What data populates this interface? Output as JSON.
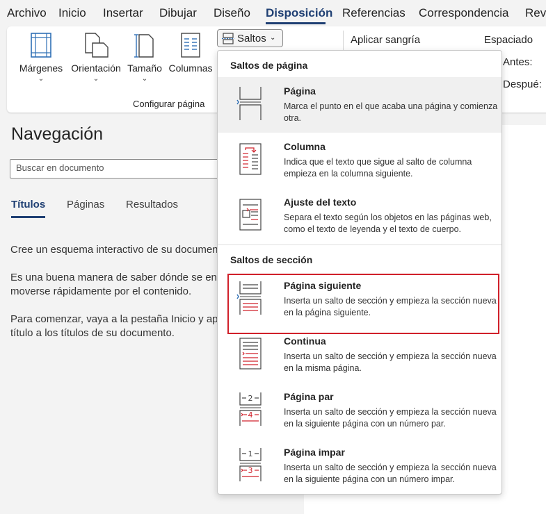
{
  "tabs": [
    "Archivo",
    "Inicio",
    "Insertar",
    "Dibujar",
    "Diseño",
    "Disposición",
    "Referencias",
    "Correspondencia",
    "Revi"
  ],
  "active_tab": "Disposición",
  "ribbon": {
    "buttons": [
      "Márgenes",
      "Orientación",
      "Tamaño",
      "Columnas"
    ],
    "group_label": "Configurar página",
    "saltos_label": "Saltos",
    "indent_label": "Aplicar sangría",
    "spacing_label": "Espaciado",
    "before_label": "Antes:",
    "after_label": "Despué:"
  },
  "nav": {
    "title": "Navegación",
    "search_placeholder": "Buscar en documento",
    "tabs": [
      "Títulos",
      "Páginas",
      "Resultados"
    ],
    "p1": "Cree un esquema interactivo de su documento",
    "p2a": "Es una buena manera de saber dónde se encuentra o",
    "p2b": "moverse rápidamente por el contenido.",
    "p3a": "Para comenzar, vaya a la pestaña Inicio y aplique estilos de",
    "p3b": "título a los títulos de su documento."
  },
  "dropdown": {
    "section1": "Saltos de página",
    "section2": "Saltos de sección",
    "items": [
      {
        "title": "Página",
        "desc": "Marca el punto en el que acaba una página y comienza otra.",
        "icon": "page-break-icon"
      },
      {
        "title": "Columna",
        "desc": "Indica que el texto que sigue al salto de columna empieza en la columna siguiente.",
        "icon": "column-break-icon"
      },
      {
        "title": "Ajuste del texto",
        "desc": "Separa el texto según los objetos en las páginas web, como el texto de leyenda y el texto de cuerpo.",
        "icon": "text-wrap-icon"
      },
      {
        "title": "Página siguiente",
        "desc": "Inserta un salto de sección y empieza la sección nueva en la página siguiente.",
        "icon": "next-page-icon"
      },
      {
        "title": "Continua",
        "desc": "Inserta un salto de sección y empieza la sección nueva en la misma página.",
        "icon": "continuous-icon"
      },
      {
        "title": "Página par",
        "desc": "Inserta un salto de sección y empieza la sección nueva en la siguiente página con un número par.",
        "icon": "even-page-icon"
      },
      {
        "title": "Página impar",
        "desc": "Inserta un salto de sección y empieza la sección nueva en la siguiente página con un número impar.",
        "icon": "odd-page-icon"
      }
    ]
  },
  "colors": {
    "accent": "#1f3f73",
    "highlight": "#d0202a",
    "icon_blue": "#2f6fb5",
    "icon_red": "#d0202a"
  }
}
